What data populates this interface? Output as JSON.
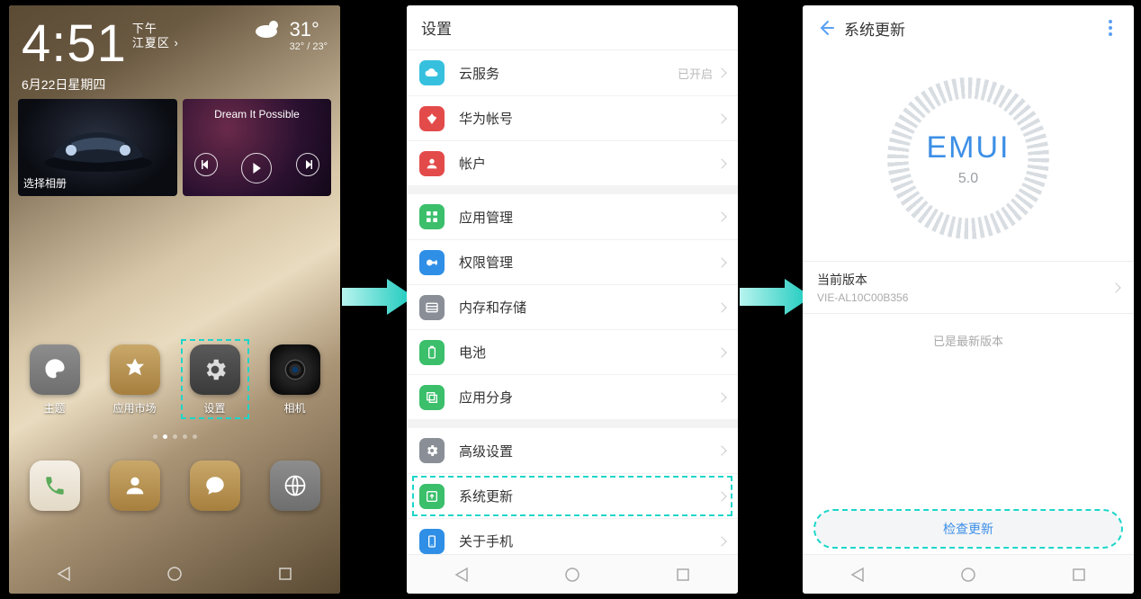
{
  "home": {
    "time": "4:51",
    "ampm": "下午",
    "location": "江夏区",
    "temp": "31°",
    "temp_hilo": "32° / 23°",
    "date": "6月22日星期四",
    "widget_album_label": "选择相册",
    "widget_music_title": "Dream It Possible",
    "apps_row": [
      {
        "label": "主题",
        "icon": "theme"
      },
      {
        "label": "应用市场",
        "icon": "market"
      },
      {
        "label": "设置",
        "icon": "settings"
      },
      {
        "label": "相机",
        "icon": "camera"
      }
    ],
    "dock": [
      {
        "icon": "phone"
      },
      {
        "icon": "contacts"
      },
      {
        "icon": "messages"
      },
      {
        "icon": "browser"
      }
    ]
  },
  "settings": {
    "title": "设置",
    "groups": [
      [
        {
          "icon": "cloud",
          "color": "#37c0de",
          "label": "云服务",
          "meta": "已开启"
        },
        {
          "icon": "huawei",
          "color": "#e34b4b",
          "label": "华为帐号"
        },
        {
          "icon": "account",
          "color": "#e34b4b",
          "label": "帐户"
        }
      ],
      [
        {
          "icon": "apps",
          "color": "#3bbf6b",
          "label": "应用管理"
        },
        {
          "icon": "perm",
          "color": "#2f8fe6",
          "label": "权限管理"
        },
        {
          "icon": "storage",
          "color": "#8a8f97",
          "label": "内存和存储"
        },
        {
          "icon": "battery",
          "color": "#3bbf6b",
          "label": "电池"
        },
        {
          "icon": "clone",
          "color": "#3bbf6b",
          "label": "应用分身"
        }
      ],
      [
        {
          "icon": "advanced",
          "color": "#8a8f97",
          "label": "高级设置"
        },
        {
          "icon": "update",
          "color": "#3bbf6b",
          "label": "系统更新",
          "highlight": true
        },
        {
          "icon": "about",
          "color": "#2f8fe6",
          "label": "关于手机"
        }
      ]
    ]
  },
  "update": {
    "title": "系统更新",
    "brand": "EMUI",
    "brand_ver": "5.0",
    "current_label": "当前版本",
    "current_value": "VIE-AL10C00B356",
    "status": "已是最新版本",
    "check_btn": "检查更新"
  }
}
